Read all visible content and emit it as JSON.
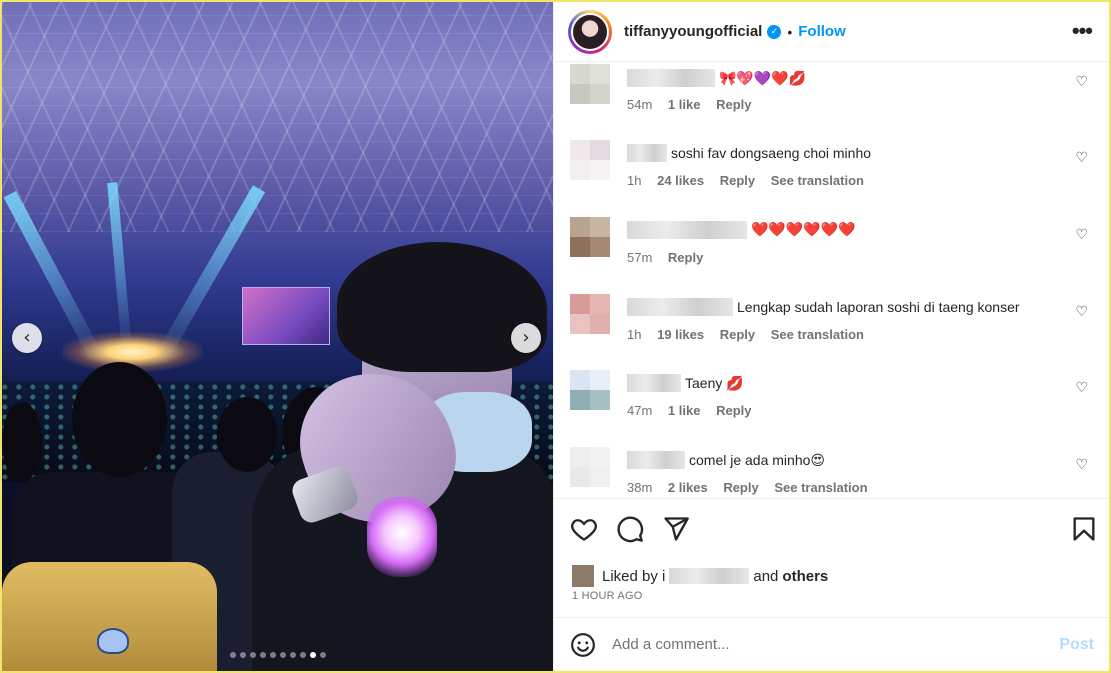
{
  "post": {
    "username": "tiffanyyoungofficial",
    "separator": "•",
    "follow_label": "Follow",
    "more_label": "•••",
    "verified_glyph": "✓"
  },
  "carousel": {
    "prev_glyph": "‹",
    "next_glyph": "›",
    "slide_count": 10,
    "active_index": 8
  },
  "comments": [
    {
      "text": "🎀💖💜❤️💋ᅟᅟᅟ",
      "time": "54m",
      "likes": "1 like",
      "reply": "Reply",
      "translation": ""
    },
    {
      "text": "soshi fav dongsaeng choi minho",
      "time": "1h",
      "likes": "24 likes",
      "reply": "Reply",
      "translation": "See translation"
    },
    {
      "text": "❤️❤️❤️❤️❤️❤️",
      "time": "57m",
      "likes": "",
      "reply": "Reply",
      "translation": ""
    },
    {
      "text": "Lengkap sudah laporan soshi di taeng konser",
      "time": "1h",
      "likes": "19 likes",
      "reply": "Reply",
      "translation": "See translation"
    },
    {
      "text": "Taeny 💋",
      "time": "47m",
      "likes": "1 like",
      "reply": "Reply",
      "translation": ""
    },
    {
      "text": "comel je ada minho😍",
      "time": "38m",
      "likes": "2 likes",
      "reply": "Reply",
      "translation": "See translation"
    }
  ],
  "likes_summary": {
    "prefix": "Liked by i",
    "suffix": "and",
    "others": "others"
  },
  "time_ago": "1 HOUR AGO",
  "composer": {
    "placeholder": "Add a comment...",
    "post_label": "Post"
  },
  "icons": {
    "heart": "heart-icon",
    "comment": "comment-icon",
    "share": "share-icon",
    "save": "bookmark-icon",
    "emoji": "emoji-icon",
    "comment_like": "heart-outline-icon"
  },
  "colors": {
    "accent": "#0095f6",
    "post_disabled": "#b3dbff",
    "muted": "#737373"
  }
}
